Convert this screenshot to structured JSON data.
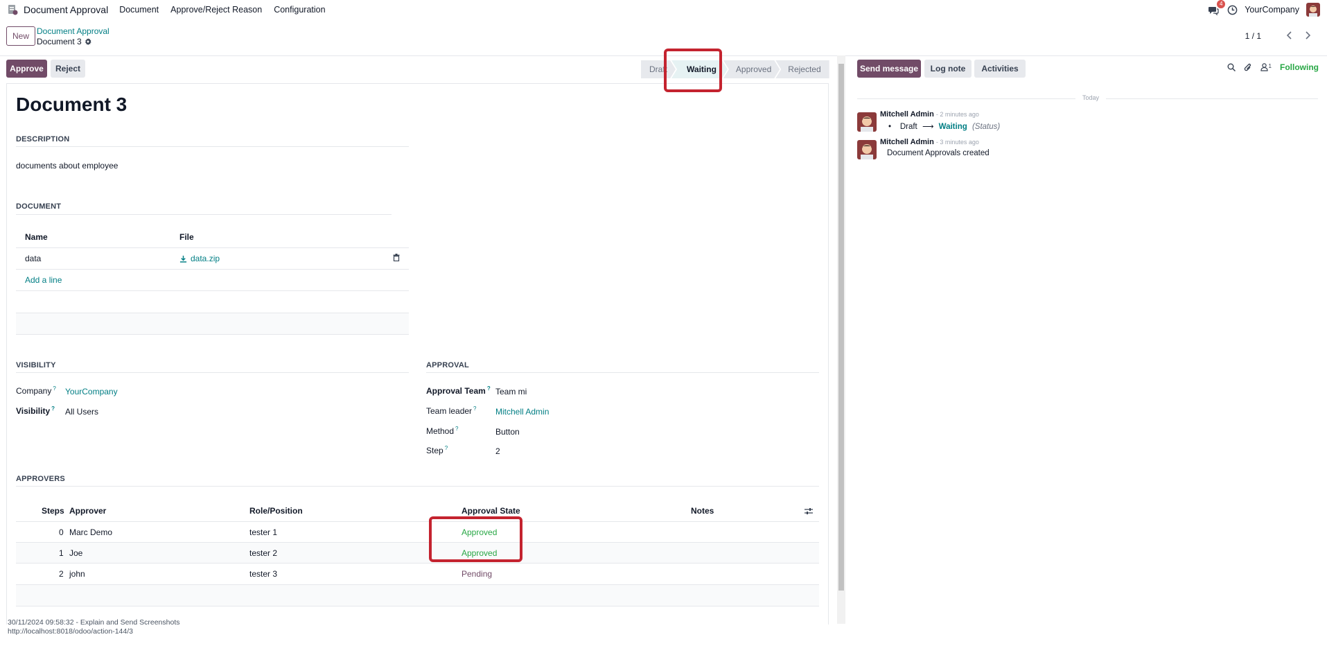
{
  "topbar": {
    "app_name": "Document Approval",
    "menu": [
      "Document",
      "Approve/Reject Reason",
      "Configuration"
    ],
    "message_count": "4",
    "company": "YourCompany"
  },
  "control_panel": {
    "new_label": "New",
    "breadcrumb_parent": "Document Approval",
    "breadcrumb_current": "Document 3",
    "pager": "1 / 1"
  },
  "status": {
    "approve_label": "Approve",
    "reject_label": "Reject",
    "stages": [
      "Draft",
      "Waiting",
      "Approved",
      "Rejected"
    ],
    "active_stage": "Waiting"
  },
  "form": {
    "title": "Document 3",
    "description_title": "DESCRIPTION",
    "description": "documents about employee",
    "document_title": "DOCUMENT",
    "doc_columns": [
      "Name",
      "File"
    ],
    "doc_rows": [
      {
        "name": "data",
        "file": "data.zip"
      }
    ],
    "add_line": "Add a line",
    "visibility_title": "VISIBILITY",
    "company_label": "Company",
    "company_value": "YourCompany",
    "visibility_label": "Visibility",
    "visibility_value": "All Users",
    "approval_title": "APPROVAL",
    "approval_team_label": "Approval Team",
    "approval_team_value": "Team mi",
    "team_leader_label": "Team leader",
    "team_leader_value": "Mitchell Admin",
    "method_label": "Method",
    "method_value": "Button",
    "step_label": "Step",
    "step_value": "2",
    "approvers_title": "APPROVERS",
    "approver_columns": [
      "Steps",
      "Approver",
      "Role/Position",
      "Approval State",
      "Notes"
    ],
    "approvers": [
      {
        "step": "0",
        "name": "Marc Demo",
        "role": "tester 1",
        "state": "Approved"
      },
      {
        "step": "1",
        "name": "Joe",
        "role": "tester 2",
        "state": "Approved"
      },
      {
        "step": "2",
        "name": "john",
        "role": "tester 3",
        "state": "Pending"
      }
    ],
    "question_mark": "?"
  },
  "chatter": {
    "send_message": "Send message",
    "log_note": "Log note",
    "activities": "Activities",
    "follower_count": "1",
    "following": "Following",
    "today": "Today",
    "messages": [
      {
        "author": "Mitchell Admin",
        "time": "- 2 minutes ago",
        "from": "Draft",
        "arrow": "⟶",
        "to": "Waiting",
        "field": "(Status)"
      },
      {
        "author": "Mitchell Admin",
        "time": "- 3 minutes ago",
        "body": "Document Approvals created"
      }
    ]
  },
  "footer": {
    "line1": "30/11/2024 09:58:32 - Explain and Send Screenshots",
    "line2": "http://localhost:8018/odoo/action-144/3"
  },
  "colors": {
    "primary": "#714b67",
    "link": "#017e84",
    "approved": "#28a745",
    "highlight": "#c4232f"
  }
}
